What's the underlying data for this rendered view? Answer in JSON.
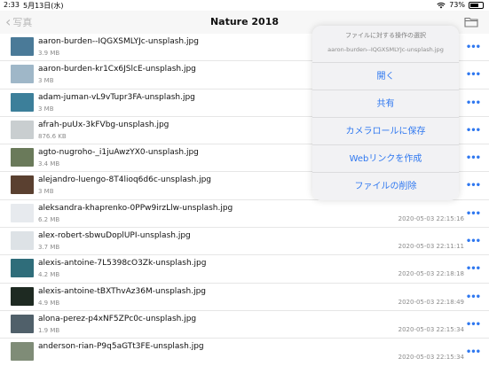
{
  "status": {
    "time": "2:33",
    "date": "5月13日(水)",
    "battery": "73%",
    "battery_level": 0.73
  },
  "nav": {
    "back_label": "写真",
    "title": "Nature 2018"
  },
  "files": [
    {
      "name": "aaron-burden--IQGXSMLYJc-unsplash.jpg",
      "size": "3.9 MB",
      "date": "",
      "thumb": "#4a7a98"
    },
    {
      "name": "aaron-burden-kr1Cx6JSlcE-unsplash.jpg",
      "size": "3 MB",
      "date": "",
      "thumb": "#9fb7c8"
    },
    {
      "name": "adam-juman-vL9vTupr3FA-unsplash.jpg",
      "size": "3 MB",
      "date": "",
      "thumb": "#3c7f9a"
    },
    {
      "name": "afrah-puUx-3kFVbg-unsplash.jpg",
      "size": "876.6 KB",
      "date": "",
      "thumb": "#c9ced0"
    },
    {
      "name": "agto-nugroho-_i1juAwzYX0-unsplash.jpg",
      "size": "3.4 MB",
      "date": "",
      "thumb": "#6a7a5a"
    },
    {
      "name": "alejandro-luengo-8T4lioq6d6c-unsplash.jpg",
      "size": "3 MB",
      "date": "",
      "thumb": "#5a4030"
    },
    {
      "name": "aleksandra-khaprenko-0PPw9irzLlw-unsplash.jpg",
      "size": "6.2 MB",
      "date": "2020-05-03 22:15:16",
      "thumb": "#e7eaee"
    },
    {
      "name": "alex-robert-sbwuDoplUPI-unsplash.jpg",
      "size": "3.7 MB",
      "date": "2020-05-03 22:11:11",
      "thumb": "#dde2e6"
    },
    {
      "name": "alexis-antoine-7L5398cO3Zk-unsplash.jpg",
      "size": "4.2 MB",
      "date": "2020-05-03 22:18:18",
      "thumb": "#2f6d7a"
    },
    {
      "name": "alexis-antoine-tBXThvAz36M-unsplash.jpg",
      "size": "4.9 MB",
      "date": "2020-05-03 22:18:49",
      "thumb": "#1e2a22"
    },
    {
      "name": "alona-perez-p4xNF5ZPc0c-unsplash.jpg",
      "size": "1.9 MB",
      "date": "2020-05-03 22:15:34",
      "thumb": "#50606a"
    },
    {
      "name": "anderson-rian-P9q5aGTt3FE-unsplash.jpg",
      "size": "",
      "date": "2020-05-03 22:15:34",
      "thumb": "#7f8c77"
    }
  ],
  "popover": {
    "title": "ファイルに対する操作の選択",
    "subtitle": "aaron-burden--IQGXSMLYJc-unsplash.jpg",
    "actions": [
      "開く",
      "共有",
      "カメラロールに保存",
      "Webリンクを作成",
      "ファイルの削除"
    ]
  },
  "colors": {
    "accent": "#2f78f0",
    "secondary_text": "#8c8c8c"
  },
  "icons": {
    "more": "ellipsis-icon",
    "folder": "folder-icon",
    "back": "chevron-left-icon"
  }
}
